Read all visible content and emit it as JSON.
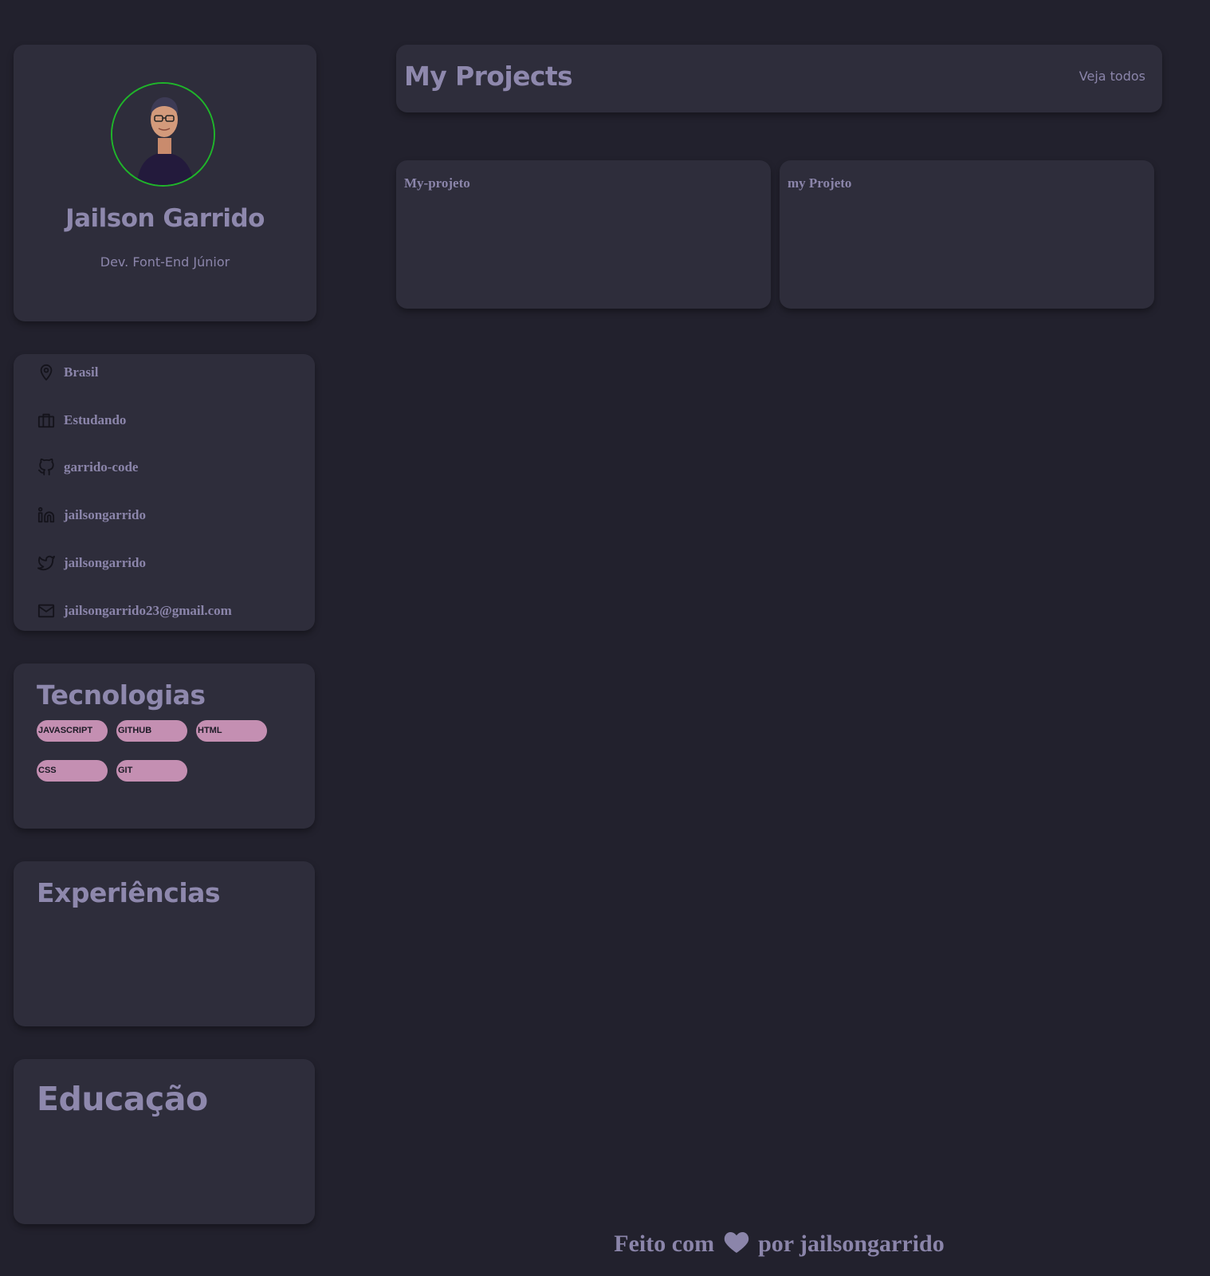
{
  "profile": {
    "name": "Jailson Garrido",
    "role": "Dev. Font-End Júnior"
  },
  "info": {
    "location": "Brasil",
    "work": "Estudando",
    "github": "garrido-code",
    "linkedin": "jailsongarrido",
    "twitter": "jailsongarrido",
    "email": "jailsongarrido23@gmail.com"
  },
  "technologies": {
    "title": "Tecnologias",
    "items": [
      "JAVASCRIPT",
      "GITHUB",
      "HTML",
      "CSS",
      "GIT"
    ]
  },
  "experiences": {
    "title": "Experiências"
  },
  "education": {
    "title": "Educação"
  },
  "projects": {
    "title": "My Projects",
    "see_all": "Veja todos",
    "items": [
      {
        "name": "My-projeto"
      },
      {
        "name": "my Projeto"
      }
    ]
  },
  "footer": {
    "prefix": "Feito com",
    "suffix": "por jailsongarrido"
  },
  "colors": {
    "background": "#22212d",
    "card": "#2e2d3b",
    "text": "#8b85aa",
    "chip": "#c48fb2",
    "avatar_ring": "#1fb52a"
  },
  "icons": {
    "location": "map-pin-icon",
    "work": "briefcase-icon",
    "github": "github-icon",
    "linkedin": "linkedin-icon",
    "twitter": "twitter-icon",
    "email": "mail-icon",
    "footer": "heart-icon"
  }
}
